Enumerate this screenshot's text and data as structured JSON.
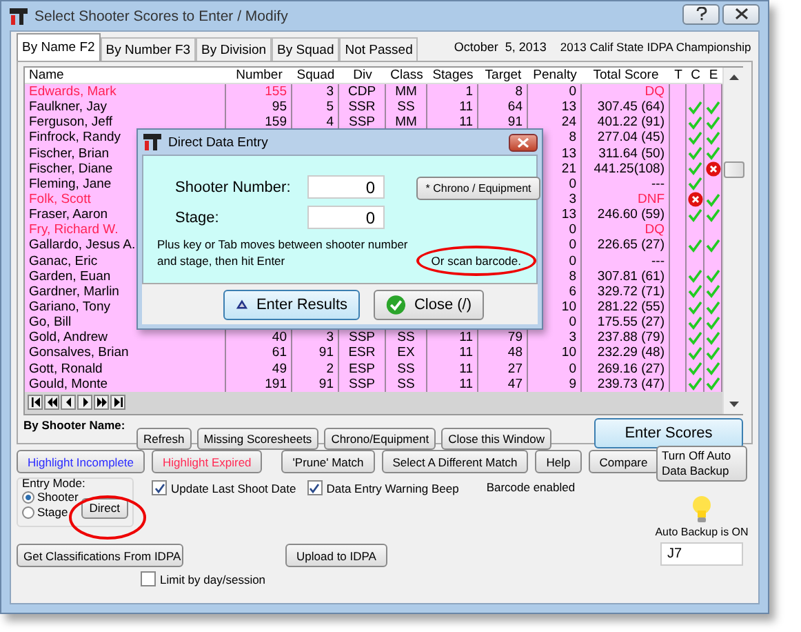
{
  "window": {
    "title": "Select Shooter Scores to Enter / Modify"
  },
  "tabs": [
    {
      "label": "By Name F2",
      "selected": true
    },
    {
      "label": "By Number F3",
      "selected": false
    },
    {
      "label": "By Division",
      "selected": false
    },
    {
      "label": "By Squad",
      "selected": false
    },
    {
      "label": "Not Passed",
      "selected": false
    }
  ],
  "match": {
    "date": "October  5, 2013",
    "name": "2013 Calif State IDPA Championship"
  },
  "table": {
    "columns": [
      "Name",
      "Number",
      "Squad",
      "Div",
      "Class",
      "Stages",
      "Target",
      "Penalty",
      "Total Score",
      "T",
      "C",
      "E"
    ],
    "rows": [
      {
        "name": "Edwards, Mark",
        "number": "155",
        "squad": "3",
        "div": "CDP",
        "class": "MM",
        "stages": "1",
        "target": "8",
        "penalty": "0",
        "total": "DQ",
        "flagged": true
      },
      {
        "name": "Faulkner, Jay",
        "number": "95",
        "squad": "5",
        "div": "SSR",
        "class": "SS",
        "stages": "11",
        "target": "64",
        "penalty": "13",
        "total": "307.45 (64)",
        "flagged": false,
        "c": {
          "kind": "check"
        },
        "e": {
          "kind": "check"
        }
      },
      {
        "name": "Ferguson, Jeff",
        "number": "159",
        "squad": "4",
        "div": "SSP",
        "class": "MM",
        "stages": "11",
        "target": "91",
        "penalty": "24",
        "total": "401.22 (91)",
        "flagged": false,
        "c": {
          "kind": "check"
        },
        "e": {
          "kind": "check"
        }
      },
      {
        "name": "Finfrock, Randy",
        "penalty": "8",
        "total": "277.04 (45)",
        "flagged": false,
        "c": {
          "kind": "check"
        },
        "e": {
          "kind": "check"
        }
      },
      {
        "name": "Fischer, Brian",
        "penalty": "13",
        "total": "311.64 (50)",
        "flagged": false,
        "c": {
          "kind": "check"
        },
        "e": {
          "kind": "check"
        }
      },
      {
        "name": "Fischer, Diane",
        "penalty": "21",
        "total": "441.25(108)",
        "flagged": false,
        "c": {
          "kind": "check"
        },
        "e": {
          "kind": "error"
        }
      },
      {
        "name": "Fleming, Jane",
        "penalty": "0",
        "total": "---",
        "flagged": false,
        "c": {
          "kind": "check"
        }
      },
      {
        "name": "Folk, Scott",
        "penalty": "3",
        "total": "DNF",
        "flagged": true,
        "c": {
          "kind": "error"
        },
        "e": {
          "kind": "check"
        }
      },
      {
        "name": "Fraser, Aaron",
        "penalty": "13",
        "total": "246.60 (59)",
        "flagged": false,
        "c": {
          "kind": "check"
        },
        "e": {
          "kind": "check"
        }
      },
      {
        "name": "Fry, Richard W.",
        "penalty": "0",
        "total": "DQ",
        "flagged": true
      },
      {
        "name": "Gallardo, Jesus A.",
        "penalty": "0",
        "total": "226.65 (27)",
        "flagged": false,
        "c": {
          "kind": "check"
        },
        "e": {
          "kind": "check"
        }
      },
      {
        "name": "Ganac, Eric",
        "penalty": "0",
        "total": "---",
        "flagged": false
      },
      {
        "name": "Garden, Euan",
        "penalty": "8",
        "total": "307.81 (61)",
        "flagged": false,
        "c": {
          "kind": "check"
        },
        "e": {
          "kind": "check"
        }
      },
      {
        "name": "Gardner, Marlin",
        "penalty": "6",
        "total": "329.72 (71)",
        "flagged": false,
        "c": {
          "kind": "check"
        },
        "e": {
          "kind": "check"
        }
      },
      {
        "name": "Gariano, Tony",
        "penalty": "10",
        "total": "281.22 (55)",
        "flagged": false,
        "c": {
          "kind": "check"
        },
        "e": {
          "kind": "check"
        }
      },
      {
        "name": "Go, Bill",
        "penalty": "0",
        "total": "175.55 (27)",
        "flagged": false,
        "c": {
          "kind": "check"
        },
        "e": {
          "kind": "check"
        }
      },
      {
        "name": "Gold, Andrew",
        "number": "40",
        "squad": "3",
        "div": "SSP",
        "class": "SS",
        "stages": "11",
        "target": "79",
        "penalty": "3",
        "total": "237.88 (79)",
        "flagged": false,
        "c": {
          "kind": "check"
        },
        "e": {
          "kind": "check"
        }
      },
      {
        "name": "Gonsalves, Brian",
        "number": "61",
        "squad": "91",
        "div": "ESR",
        "class": "EX",
        "stages": "11",
        "target": "48",
        "penalty": "10",
        "total": "232.29 (48)",
        "flagged": false,
        "c": {
          "kind": "check"
        },
        "e": {
          "kind": "check"
        }
      },
      {
        "name": "Gott, Ronald",
        "number": "49",
        "squad": "2",
        "div": "ESP",
        "class": "SS",
        "stages": "11",
        "target": "27",
        "penalty": "0",
        "total": "269.16 (27)",
        "flagged": false,
        "c": {
          "kind": "check"
        },
        "e": {
          "kind": "check"
        }
      },
      {
        "name": "Gould, Monte",
        "number": "191",
        "squad": "91",
        "div": "SSP",
        "class": "SS",
        "stages": "11",
        "target": "47",
        "penalty": "9",
        "total": "239.73 (47)",
        "flagged": false,
        "c": {
          "kind": "check"
        },
        "e": {
          "kind": "check"
        }
      }
    ]
  },
  "shooter_label": "By Shooter Name:",
  "action_buttons": [
    "Refresh",
    "Missing Scoresheets",
    "Chrono/Equipment",
    "Close this Window"
  ],
  "enter_scores_button": "Enter Scores",
  "toolbar": [
    {
      "label": "Highlight Incomplete",
      "color": "#2b2bff"
    },
    {
      "label": "Highlight Expired",
      "color": "#ff2b55"
    },
    {
      "label": "'Prune' Match"
    },
    {
      "label": "Select A Different  Match"
    },
    {
      "label": "Help"
    },
    {
      "label": "Compare"
    }
  ],
  "entry_mode": {
    "label": "Entry Mode:",
    "options": [
      {
        "label": "Shooter",
        "selected": true
      },
      {
        "label": "Stage",
        "selected": false
      }
    ],
    "direct_button": "Direct"
  },
  "checkboxes": [
    {
      "label": "Update Last Shoot Date",
      "checked": true
    },
    {
      "label": "Data Entry Warning Beep",
      "checked": true
    }
  ],
  "barcode_status": "Barcode enabled",
  "backup": {
    "button": "Turn Off Auto Data Backup",
    "on": true,
    "status": "Auto Backup is ON",
    "field_value": "J7"
  },
  "bottom_buttons": [
    "Get Classifications From IDPA",
    "Upload to IDPA"
  ],
  "limit_checkbox": {
    "label": "Limit by day/session",
    "checked": false
  },
  "dialog": {
    "title": "Direct Data Entry",
    "fields": [
      {
        "label": "Shooter Number:",
        "value": "0"
      },
      {
        "label": "Stage:",
        "value": "0"
      }
    ],
    "chrono_button": "* Chrono / Equipment",
    "hint": "Plus key or Tab moves between shooter number and stage, then hit Enter",
    "scan_hint": "Or scan barcode.",
    "buttons": [
      {
        "label": "Enter Results",
        "kind": "enter"
      },
      {
        "label": "Close  (/)",
        "kind": "close"
      }
    ]
  }
}
